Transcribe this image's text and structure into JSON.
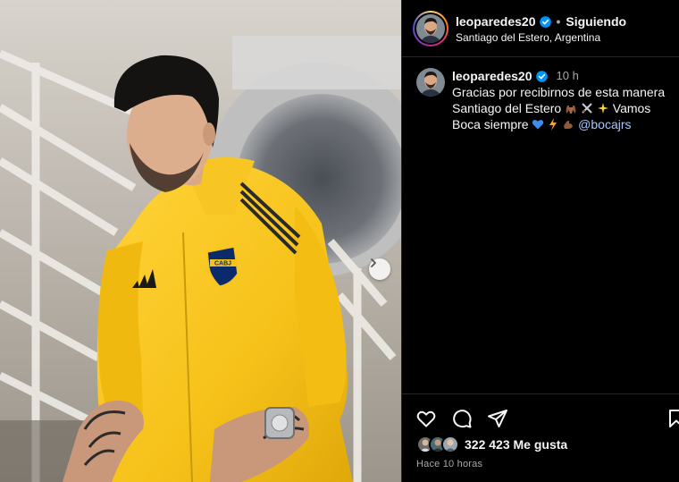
{
  "post": {
    "username": "leoparedes20",
    "follow_status": "Siguiendo",
    "location": "Santiago del Estero, Argentina"
  },
  "caption": {
    "username": "leoparedes20",
    "time": "10 h",
    "line1": "Gracias por recibirnos de esta manera",
    "line2_text": "Santiago del Estero",
    "line2_after": "Vamos",
    "line3_text": "Boca siempre",
    "mention": "@bocajrs",
    "emojis": [
      "raised-hands-emoji",
      "crossed-swords-emoji",
      "sparkles-emoji",
      "blue-heart-emoji",
      "lightning-emoji",
      "flexed-biceps-emoji"
    ]
  },
  "engagement": {
    "likes_count": "322 423",
    "likes_label": "Me gusta",
    "posted": "Hace 10 horas"
  },
  "photo": {
    "crest_text": "CABJ",
    "jacket_color": "#f6c21a",
    "crest_color": "#0b2a6b"
  },
  "colors": {
    "background": "#000000",
    "divider": "#262626",
    "verified": "#0095f6",
    "secondary_text": "#a8a8a8"
  }
}
